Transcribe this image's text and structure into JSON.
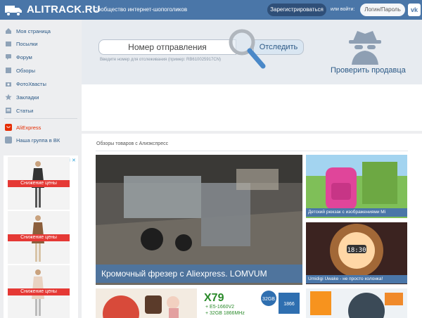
{
  "header": {
    "logo_text": "ALITRACK.RU",
    "slogan": "Сообщество интернет-шопоголиков",
    "register_label": "Зарегистрироваться",
    "or_login_label": "или войти:",
    "login_label": "Логин/Пароль",
    "vk_label": "vk"
  },
  "sidebar": {
    "items": [
      {
        "label": "Моя страница",
        "icon": "home-icon"
      },
      {
        "label": "Посылки",
        "icon": "package-icon"
      },
      {
        "label": "Форум",
        "icon": "forum-icon"
      },
      {
        "label": "Обзоры",
        "icon": "reviews-icon"
      },
      {
        "label": "ФотоХвасты",
        "icon": "camera-icon"
      },
      {
        "label": "Закладки",
        "icon": "star-icon"
      },
      {
        "label": "Статьи",
        "icon": "articles-icon"
      },
      {
        "label": "AliExpress",
        "icon": "aliexpress-icon"
      },
      {
        "label": "Наша группа в ВК",
        "icon": "vk-icon"
      }
    ],
    "ad_label": "Снижение цены",
    "ad_badge": "ⓘ ✕"
  },
  "tracking": {
    "input_placeholder": "Номер отправления",
    "track_button": "Отследить",
    "hint": "Введите номер для отслеживания (пример: RB610025917CN)",
    "check_seller": "Проверить продавца"
  },
  "reviews": {
    "title": "Обзоры товаров с Алиэкспресс",
    "cards": [
      {
        "label": "Кромочный фрезер с Aliexpress. LOMVUM"
      },
      {
        "label": "Детский рюкзак с изображениями Mi"
      },
      {
        "label": "Umidigi Uwake - не просто колонка!"
      }
    ],
    "thumb_texts": {
      "x79": "X79",
      "spec": "+ E5-1660V2\n+ 32GB 1866MHz",
      "ram": "32GB 1866"
    }
  },
  "colors": {
    "header": "#4a76a8",
    "link": "#2a5885",
    "ad_red": "#e53935"
  }
}
